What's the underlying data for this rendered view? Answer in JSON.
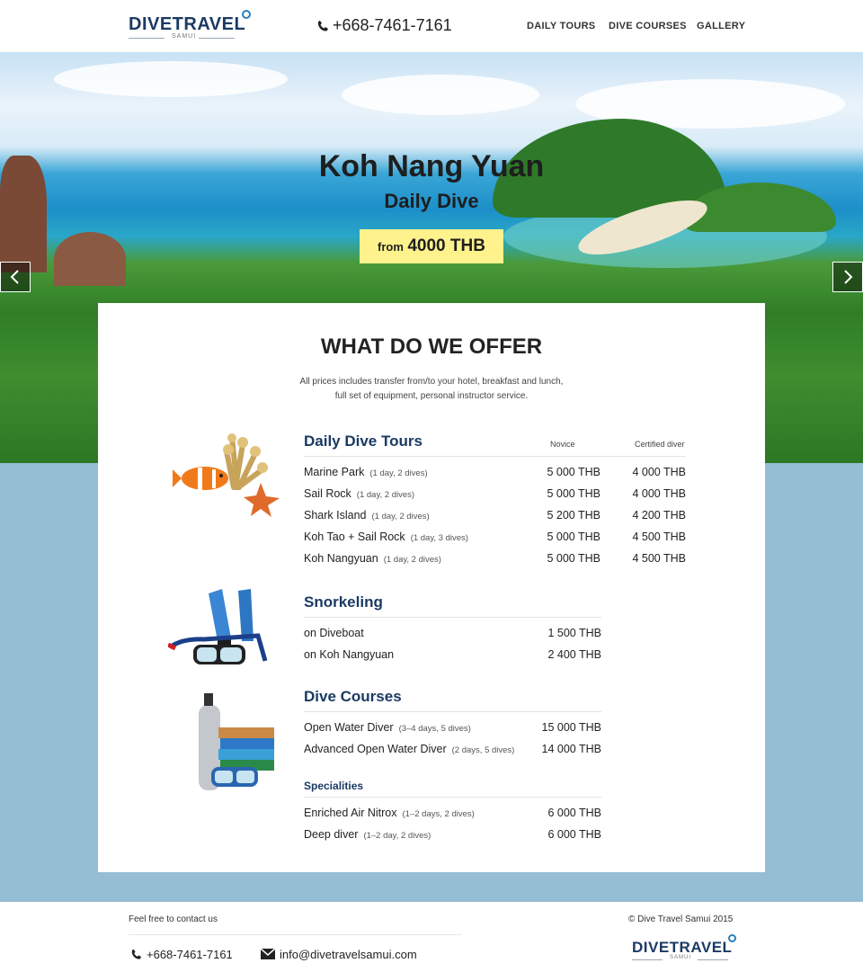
{
  "header": {
    "logo_text": "DIVETRAVEL",
    "logo_sub": "SAMUI",
    "phone": "+668-7461-7161",
    "nav": [
      "DAILY TOURS",
      "DIVE COURSES",
      "GALLERY"
    ]
  },
  "hero": {
    "title": "Koh Nang Yuan",
    "subtitle": "Daily Dive",
    "price_prefix": "from",
    "price_amount": "4000 THB",
    "prev_icon": "chevron-left-icon",
    "next_icon": "chevron-right-icon"
  },
  "offer": {
    "title": "WHAT DO WE OFFER",
    "desc_line1": "All prices includes transfer from/to your hotel, breakfast and lunch,",
    "desc_line2": "full set of equipment, personal instructor service.",
    "daily": {
      "title": "Daily Dive Tours",
      "col_novice": "Novice",
      "col_certified": "Certified diver",
      "rows": [
        {
          "name": "Marine Park",
          "detail": "(1 day, 2 dives)",
          "novice": "5 000 THB",
          "certified": "4 000 THB"
        },
        {
          "name": "Sail Rock",
          "detail": "(1 day, 2 dives)",
          "novice": "5 000 THB",
          "certified": "4 000 THB"
        },
        {
          "name": "Shark Island",
          "detail": "(1 day, 2 dives)",
          "novice": "5 200 THB",
          "certified": "4 200 THB"
        },
        {
          "name": "Koh Tao + Sail Rock",
          "detail": "(1 day, 3 dives)",
          "novice": "5 000 THB",
          "certified": "4 500 THB"
        },
        {
          "name": "Koh Nangyuan",
          "detail": "(1 day, 2 dives)",
          "novice": "5 000 THB",
          "certified": "4 500 THB"
        }
      ]
    },
    "snorkeling": {
      "title": "Snorkeling",
      "rows": [
        {
          "name": "on Diveboat",
          "price": "1 500 THB"
        },
        {
          "name": "on Koh Nangyuan",
          "price": "2 400 THB"
        }
      ]
    },
    "courses": {
      "title": "Dive Courses",
      "rows": [
        {
          "name": "Open Water Diver",
          "detail": "(3–4 days, 5 dives)",
          "price": "15 000 THB"
        },
        {
          "name": "Advanced Open Water Diver",
          "detail": "(2 days, 5 dives)",
          "price": "14 000 THB"
        }
      ]
    },
    "specialities": {
      "title": "Specialities",
      "rows": [
        {
          "name": "Enriched Air Nitrox",
          "detail": "(1–2 days, 2 dives)",
          "price": "6 000 THB"
        },
        {
          "name": "Deep diver",
          "detail": "(1–2 day, 2 dives)",
          "price": "6 000 THB"
        }
      ]
    }
  },
  "footer": {
    "contact_label": "Feel free to contact us",
    "phone": "+668-7461-7161",
    "email": "info@divetravelsamui.com",
    "copyright": "© Dive Travel Samui 2015",
    "logo_text": "DIVETRAVEL",
    "logo_sub": "SAMUI"
  },
  "colors": {
    "brand": "#1b3a63",
    "price_badge": "#fdf28c",
    "page_bg": "#95bdd4"
  }
}
